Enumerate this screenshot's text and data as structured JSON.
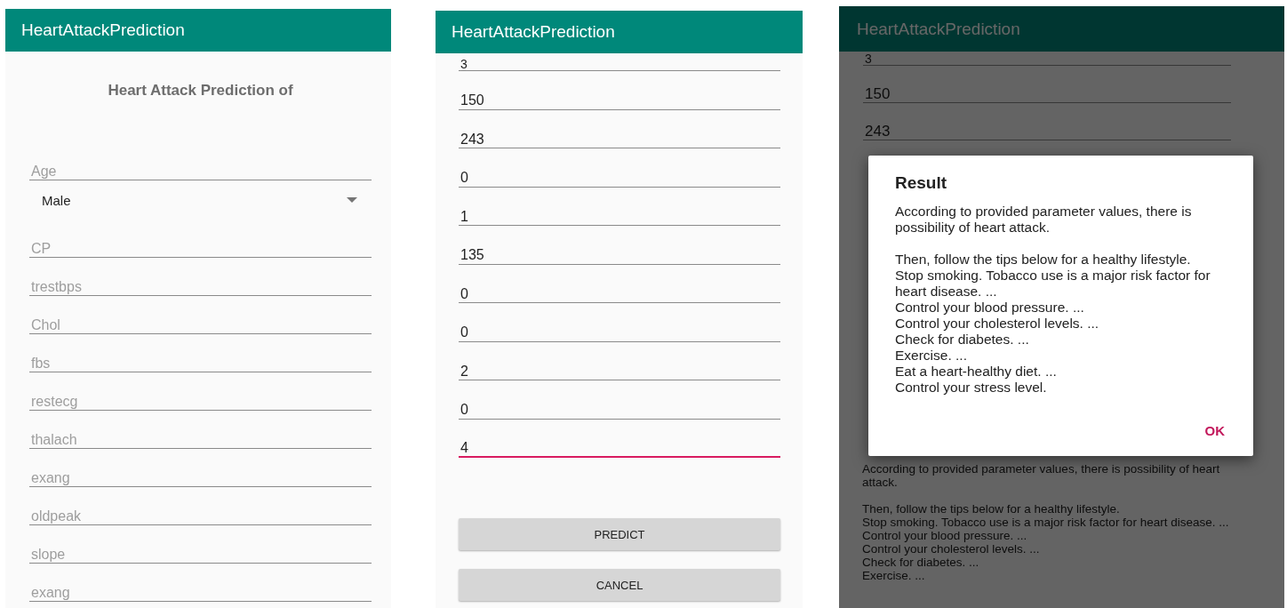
{
  "screens": [
    {
      "kind": "form",
      "app_bar": {
        "title": "HeartAttackPrediction"
      },
      "heading": "Heart Attack Prediction of",
      "fields": [
        {
          "kind": "text",
          "placeholder": "Age",
          "focused": false
        },
        {
          "kind": "spinner",
          "value": "Male"
        },
        {
          "kind": "text",
          "placeholder": "CP",
          "focused": false
        },
        {
          "kind": "text",
          "placeholder": "trestbps",
          "focused": false
        },
        {
          "kind": "text",
          "placeholder": "Chol",
          "focused": false
        },
        {
          "kind": "text",
          "placeholder": "fbs",
          "focused": false
        },
        {
          "kind": "text",
          "placeholder": "restecg",
          "focused": false
        },
        {
          "kind": "text",
          "placeholder": "thalach",
          "focused": false
        },
        {
          "kind": "text",
          "placeholder": "exang",
          "focused": false
        },
        {
          "kind": "text",
          "placeholder": "oldpeak",
          "focused": false
        },
        {
          "kind": "text",
          "placeholder": "slope",
          "focused": false
        },
        {
          "kind": "text",
          "placeholder": "exang",
          "focused": false
        }
      ]
    },
    {
      "kind": "form",
      "app_bar": {
        "title": "HeartAttackPrediction"
      },
      "fields": [
        {
          "kind": "text",
          "value": "3",
          "focused": false
        },
        {
          "kind": "text",
          "value": "150",
          "focused": false
        },
        {
          "kind": "text",
          "value": "243",
          "focused": false
        },
        {
          "kind": "text",
          "value": "0",
          "focused": false
        },
        {
          "kind": "text",
          "value": "1",
          "focused": false
        },
        {
          "kind": "text",
          "value": "135",
          "focused": false
        },
        {
          "kind": "text",
          "value": "0",
          "focused": false
        },
        {
          "kind": "text",
          "value": "0",
          "focused": false
        },
        {
          "kind": "text",
          "value": "2",
          "focused": false
        },
        {
          "kind": "text",
          "value": "0",
          "focused": false
        },
        {
          "kind": "text",
          "value": "4",
          "focused": true
        }
      ],
      "buttons": [
        "PREDICT",
        "CANCEL"
      ]
    },
    {
      "kind": "dialog",
      "app_bar": {
        "title": "HeartAttackPrediction"
      },
      "fields": [
        {
          "kind": "text",
          "value": "3",
          "focused": false
        },
        {
          "kind": "text",
          "value": "150",
          "focused": false
        },
        {
          "kind": "text",
          "value": "243",
          "focused": false
        }
      ],
      "result_text": [
        "According to provided parameter values, there is possibility of heart attack.",
        "Then, follow the tips below for a healthy lifestyle.\nStop smoking. Tobacco use is a major risk factor for heart disease. ...\nControl your blood pressure. ...\nControl your cholesterol levels. ...\nCheck for diabetes. ...\nExercise. ..."
      ],
      "dialog": {
        "title": "Result",
        "message": "According to provided parameter values, there is possibility of heart attack.\n\nThen, follow the tips below for a healthy lifestyle.\nStop smoking. Tobacco use is a major risk factor for heart disease. ...\nControl your blood pressure. ...\nControl your cholesterol levels. ...\nCheck for diabetes. ...\nExercise. ...\nEat a heart-healthy diet. ...\nControl your stress level.",
        "button": "OK"
      }
    }
  ]
}
